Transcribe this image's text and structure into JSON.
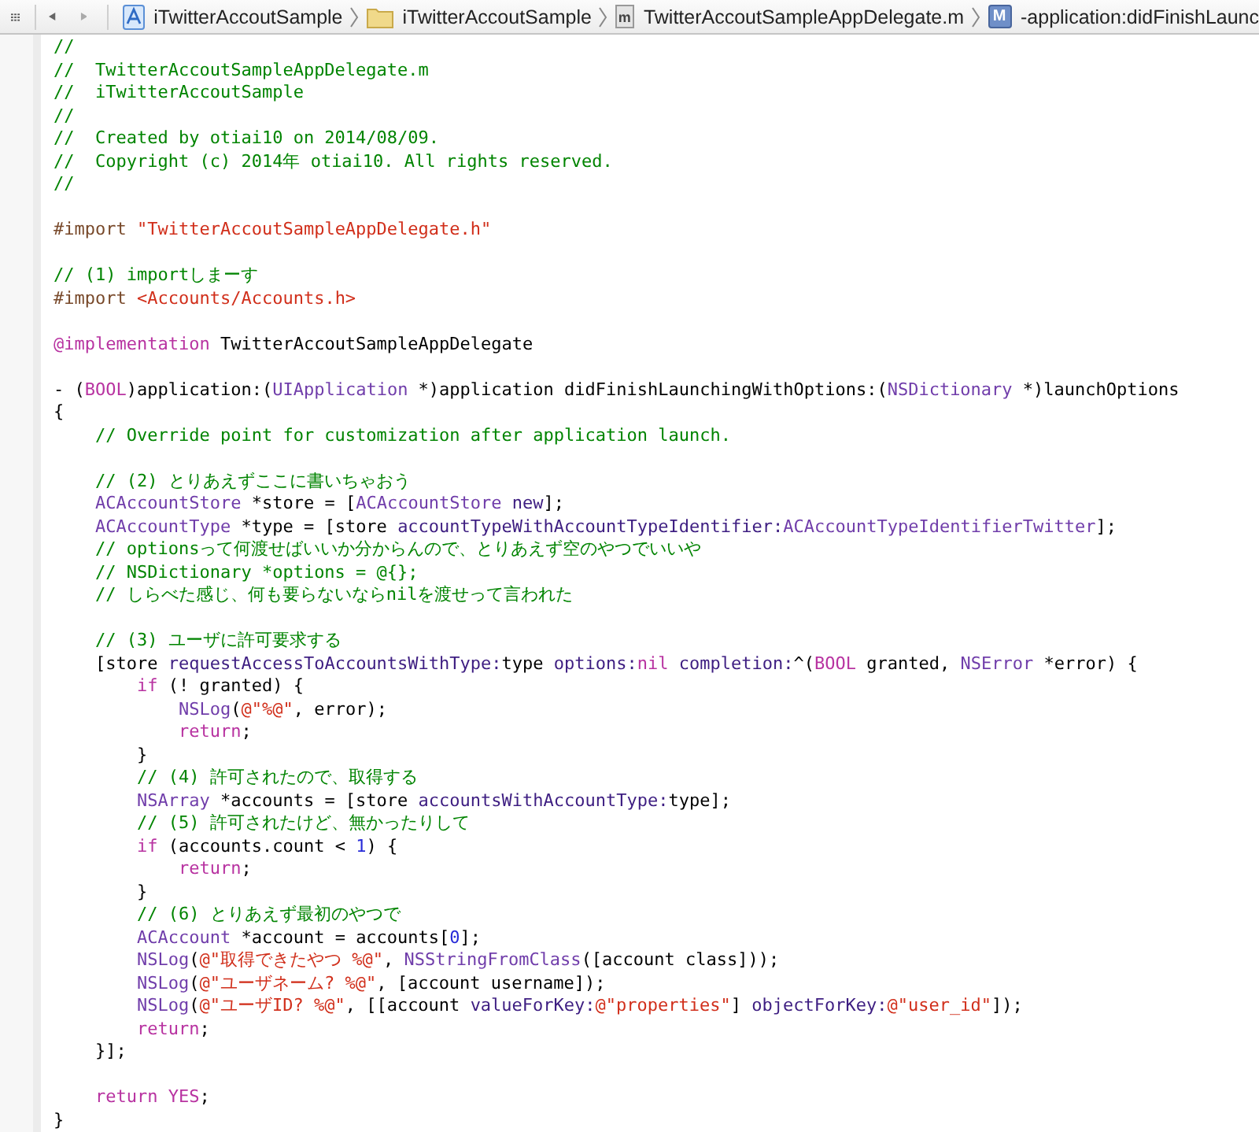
{
  "jump_bar": {
    "breadcrumbs": [
      {
        "kind": "project",
        "label": "iTwitterAccoutSample"
      },
      {
        "kind": "folder",
        "label": "iTwitterAccoutSample"
      },
      {
        "kind": "file",
        "icon_letter": "m",
        "label": "TwitterAccoutSampleAppDelegate.m"
      },
      {
        "kind": "method",
        "icon_letter": "M",
        "label": "-application:didFinishLaunc"
      }
    ]
  },
  "editor": {
    "lines": [
      {
        "kind": "code",
        "tokens": [
          {
            "kind": "comment",
            "text": "//"
          }
        ]
      },
      {
        "kind": "code",
        "tokens": [
          {
            "kind": "comment",
            "text": "//  TwitterAccoutSampleAppDelegate.m"
          }
        ]
      },
      {
        "kind": "code",
        "tokens": [
          {
            "kind": "comment",
            "text": "//  iTwitterAccoutSample"
          }
        ]
      },
      {
        "kind": "code",
        "tokens": [
          {
            "kind": "comment",
            "text": "//"
          }
        ]
      },
      {
        "kind": "code",
        "tokens": [
          {
            "kind": "comment",
            "text": "//  Created by otiai10 on 2014/08/09."
          }
        ]
      },
      {
        "kind": "code",
        "tokens": [
          {
            "kind": "comment",
            "text": "//  Copyright (c) 2014年 otiai10. All rights reserved."
          }
        ]
      },
      {
        "kind": "code",
        "tokens": [
          {
            "kind": "comment",
            "text": "//"
          }
        ]
      },
      {
        "kind": "blank"
      },
      {
        "kind": "code",
        "tokens": [
          {
            "kind": "preprocessor",
            "text": "#import "
          },
          {
            "kind": "string",
            "text": "\"TwitterAccoutSampleAppDelegate.h\""
          }
        ]
      },
      {
        "kind": "blank"
      },
      {
        "kind": "code",
        "tokens": [
          {
            "kind": "comment",
            "text": "// (1) importしまーす"
          }
        ]
      },
      {
        "kind": "code",
        "tokens": [
          {
            "kind": "preprocessor",
            "text": "#import "
          },
          {
            "kind": "string",
            "text": "<Accounts/Accounts.h>"
          }
        ]
      },
      {
        "kind": "blank"
      },
      {
        "kind": "code",
        "tokens": [
          {
            "kind": "keyword",
            "text": "@implementation"
          },
          {
            "kind": "plain",
            "text": " TwitterAccoutSampleAppDelegate"
          }
        ]
      },
      {
        "kind": "blank"
      },
      {
        "kind": "code",
        "tokens": [
          {
            "kind": "plain",
            "text": "- ("
          },
          {
            "kind": "keyword",
            "text": "BOOL"
          },
          {
            "kind": "plain",
            "text": ")application:("
          },
          {
            "kind": "type",
            "text": "UIApplication"
          },
          {
            "kind": "plain",
            "text": " *)application didFinishLaunchingWithOptions:("
          },
          {
            "kind": "type",
            "text": "NSDictionary"
          },
          {
            "kind": "plain",
            "text": " *)launchOptions"
          }
        ]
      },
      {
        "kind": "code",
        "tokens": [
          {
            "kind": "plain",
            "text": "{"
          }
        ]
      },
      {
        "kind": "code",
        "tokens": [
          {
            "kind": "comment",
            "text": "    // Override point for customization after application launch."
          }
        ]
      },
      {
        "kind": "blank"
      },
      {
        "kind": "code",
        "tokens": [
          {
            "kind": "comment",
            "text": "    // (2) とりあえずここに書いちゃおう"
          }
        ]
      },
      {
        "kind": "code",
        "tokens": [
          {
            "kind": "type",
            "text": "    ACAccountStore"
          },
          {
            "kind": "plain",
            "text": " *store = ["
          },
          {
            "kind": "type",
            "text": "ACAccountStore"
          },
          {
            "kind": "method",
            "text": " new"
          },
          {
            "kind": "plain",
            "text": "];"
          }
        ]
      },
      {
        "kind": "code",
        "tokens": [
          {
            "kind": "type",
            "text": "    ACAccountType"
          },
          {
            "kind": "plain",
            "text": " *type = [store "
          },
          {
            "kind": "method",
            "text": "accountTypeWithAccountTypeIdentifier:"
          },
          {
            "kind": "type",
            "text": "ACAccountTypeIdentifierTwitter"
          },
          {
            "kind": "plain",
            "text": "];"
          }
        ]
      },
      {
        "kind": "code",
        "tokens": [
          {
            "kind": "comment",
            "text": "    // optionsって何渡せばいいか分からんので、とりあえず空のやつでいいや"
          }
        ]
      },
      {
        "kind": "code",
        "tokens": [
          {
            "kind": "comment",
            "text": "    // NSDictionary *options = @{};"
          }
        ]
      },
      {
        "kind": "code",
        "tokens": [
          {
            "kind": "comment",
            "text": "    // しらべた感じ、何も要らないならnilを渡せって言われた"
          }
        ]
      },
      {
        "kind": "blank"
      },
      {
        "kind": "code",
        "tokens": [
          {
            "kind": "comment",
            "text": "    // (3) ユーザに許可要求する"
          }
        ]
      },
      {
        "kind": "code",
        "tokens": [
          {
            "kind": "plain",
            "text": "    [store "
          },
          {
            "kind": "method",
            "text": "requestAccessToAccountsWithType:"
          },
          {
            "kind": "plain",
            "text": "type "
          },
          {
            "kind": "method",
            "text": "options:"
          },
          {
            "kind": "keyword",
            "text": "nil"
          },
          {
            "kind": "method",
            "text": " completion:"
          },
          {
            "kind": "plain",
            "text": "^("
          },
          {
            "kind": "keyword",
            "text": "BOOL"
          },
          {
            "kind": "plain",
            "text": " granted, "
          },
          {
            "kind": "type",
            "text": "NSError"
          },
          {
            "kind": "plain",
            "text": " *error) {"
          }
        ]
      },
      {
        "kind": "code",
        "tokens": [
          {
            "kind": "keyword",
            "text": "        if"
          },
          {
            "kind": "plain",
            "text": " (! granted) {"
          }
        ]
      },
      {
        "kind": "code",
        "tokens": [
          {
            "kind": "type",
            "text": "            NSLog"
          },
          {
            "kind": "plain",
            "text": "("
          },
          {
            "kind": "string",
            "text": "@\"%@\""
          },
          {
            "kind": "plain",
            "text": ", error);"
          }
        ]
      },
      {
        "kind": "code",
        "tokens": [
          {
            "kind": "keyword",
            "text": "            return"
          },
          {
            "kind": "plain",
            "text": ";"
          }
        ]
      },
      {
        "kind": "code",
        "tokens": [
          {
            "kind": "plain",
            "text": "        }"
          }
        ]
      },
      {
        "kind": "code",
        "tokens": [
          {
            "kind": "comment",
            "text": "        // (4) 許可されたので、取得する"
          }
        ]
      },
      {
        "kind": "code",
        "tokens": [
          {
            "kind": "type",
            "text": "        NSArray"
          },
          {
            "kind": "plain",
            "text": " *accounts = [store "
          },
          {
            "kind": "method",
            "text": "accountsWithAccountType:"
          },
          {
            "kind": "plain",
            "text": "type];"
          }
        ]
      },
      {
        "kind": "code",
        "tokens": [
          {
            "kind": "comment",
            "text": "        // (5) 許可されたけど、無かったりして"
          }
        ]
      },
      {
        "kind": "code",
        "tokens": [
          {
            "kind": "keyword",
            "text": "        if"
          },
          {
            "kind": "plain",
            "text": " (accounts.count < "
          },
          {
            "kind": "number",
            "text": "1"
          },
          {
            "kind": "plain",
            "text": ") {"
          }
        ]
      },
      {
        "kind": "code",
        "tokens": [
          {
            "kind": "keyword",
            "text": "            return"
          },
          {
            "kind": "plain",
            "text": ";"
          }
        ]
      },
      {
        "kind": "code",
        "tokens": [
          {
            "kind": "plain",
            "text": "        }"
          }
        ]
      },
      {
        "kind": "code",
        "tokens": [
          {
            "kind": "comment",
            "text": "        // (6) とりあえず最初のやつで"
          }
        ]
      },
      {
        "kind": "code",
        "tokens": [
          {
            "kind": "type",
            "text": "        ACAccount"
          },
          {
            "kind": "plain",
            "text": " *account = accounts["
          },
          {
            "kind": "number",
            "text": "0"
          },
          {
            "kind": "plain",
            "text": "];"
          }
        ]
      },
      {
        "kind": "code",
        "tokens": [
          {
            "kind": "type",
            "text": "        NSLog"
          },
          {
            "kind": "plain",
            "text": "("
          },
          {
            "kind": "string",
            "text": "@\"取得できたやつ %@\""
          },
          {
            "kind": "plain",
            "text": ", "
          },
          {
            "kind": "type",
            "text": "NSStringFromClass"
          },
          {
            "kind": "plain",
            "text": "([account class]));"
          }
        ]
      },
      {
        "kind": "code",
        "tokens": [
          {
            "kind": "type",
            "text": "        NSLog"
          },
          {
            "kind": "plain",
            "text": "("
          },
          {
            "kind": "string",
            "text": "@\"ユーザネーム? %@\""
          },
          {
            "kind": "plain",
            "text": ", [account username]);"
          }
        ]
      },
      {
        "kind": "code",
        "tokens": [
          {
            "kind": "type",
            "text": "        NSLog"
          },
          {
            "kind": "plain",
            "text": "("
          },
          {
            "kind": "string",
            "text": "@\"ユーザID? %@\""
          },
          {
            "kind": "plain",
            "text": ", [[account "
          },
          {
            "kind": "method",
            "text": "valueForKey:"
          },
          {
            "kind": "string",
            "text": "@\"properties\""
          },
          {
            "kind": "plain",
            "text": "] "
          },
          {
            "kind": "method",
            "text": "objectForKey:"
          },
          {
            "kind": "string",
            "text": "@\"user_id\""
          },
          {
            "kind": "plain",
            "text": "]);"
          }
        ]
      },
      {
        "kind": "code",
        "tokens": [
          {
            "kind": "keyword",
            "text": "        return"
          },
          {
            "kind": "plain",
            "text": ";"
          }
        ]
      },
      {
        "kind": "code",
        "tokens": [
          {
            "kind": "plain",
            "text": "    }];"
          }
        ]
      },
      {
        "kind": "blank"
      },
      {
        "kind": "code",
        "tokens": [
          {
            "kind": "keyword",
            "text": "    return"
          },
          {
            "kind": "keyword",
            "text": " YES"
          },
          {
            "kind": "plain",
            "text": ";"
          }
        ]
      },
      {
        "kind": "code",
        "tokens": [
          {
            "kind": "plain",
            "text": "}"
          }
        ]
      }
    ]
  }
}
